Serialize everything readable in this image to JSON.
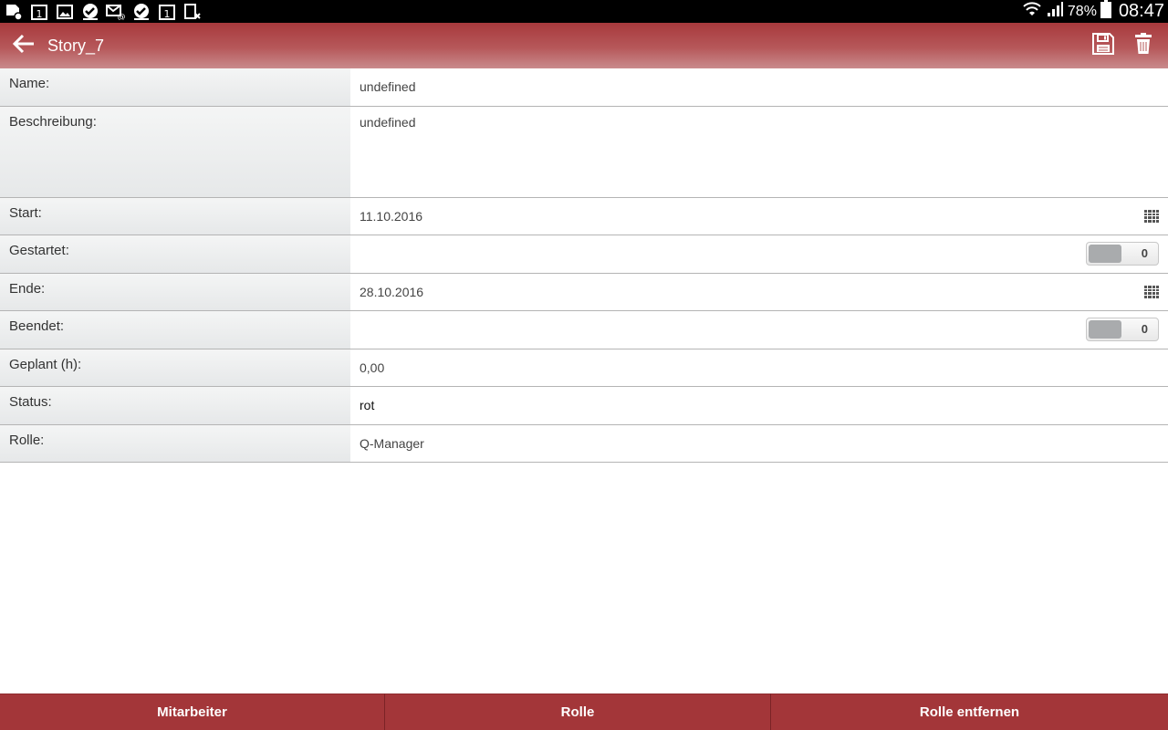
{
  "statusbar": {
    "battery": "78%",
    "time": "08:47",
    "notification_icons": [
      "sd-card-settings-icon",
      "calendar-icon",
      "image-icon",
      "check-icon",
      "email-icon",
      "check-icon",
      "calendar-icon",
      "sim-icon"
    ]
  },
  "appbar": {
    "title": "Story_7",
    "back_icon": "arrow-left-icon",
    "save_icon": "save-icon",
    "delete_icon": "trash-icon"
  },
  "form": {
    "name": {
      "label": "Name:",
      "value": "undefined"
    },
    "beschreibung": {
      "label": "Beschreibung:",
      "value": "undefined"
    },
    "start": {
      "label": "Start:",
      "value": "11.10.2016"
    },
    "gestartet": {
      "label": "Gestartet:",
      "value": "0"
    },
    "ende": {
      "label": "Ende:",
      "value": "28.10.2016"
    },
    "beendet": {
      "label": "Beendet:",
      "value": "0"
    },
    "geplant": {
      "label": "Geplant (h):",
      "value": "0,00"
    },
    "status": {
      "label": "Status:",
      "value": "rot"
    },
    "rolle": {
      "label": "Rolle:",
      "value": "Q-Manager"
    }
  },
  "bottombar": {
    "mitarbeiter": "Mitarbeiter",
    "rolle": "Rolle",
    "rolle_entfernen": "Rolle entfernen"
  },
  "colors": {
    "accent": "#a33639",
    "label_bg": "#e9ebec"
  }
}
